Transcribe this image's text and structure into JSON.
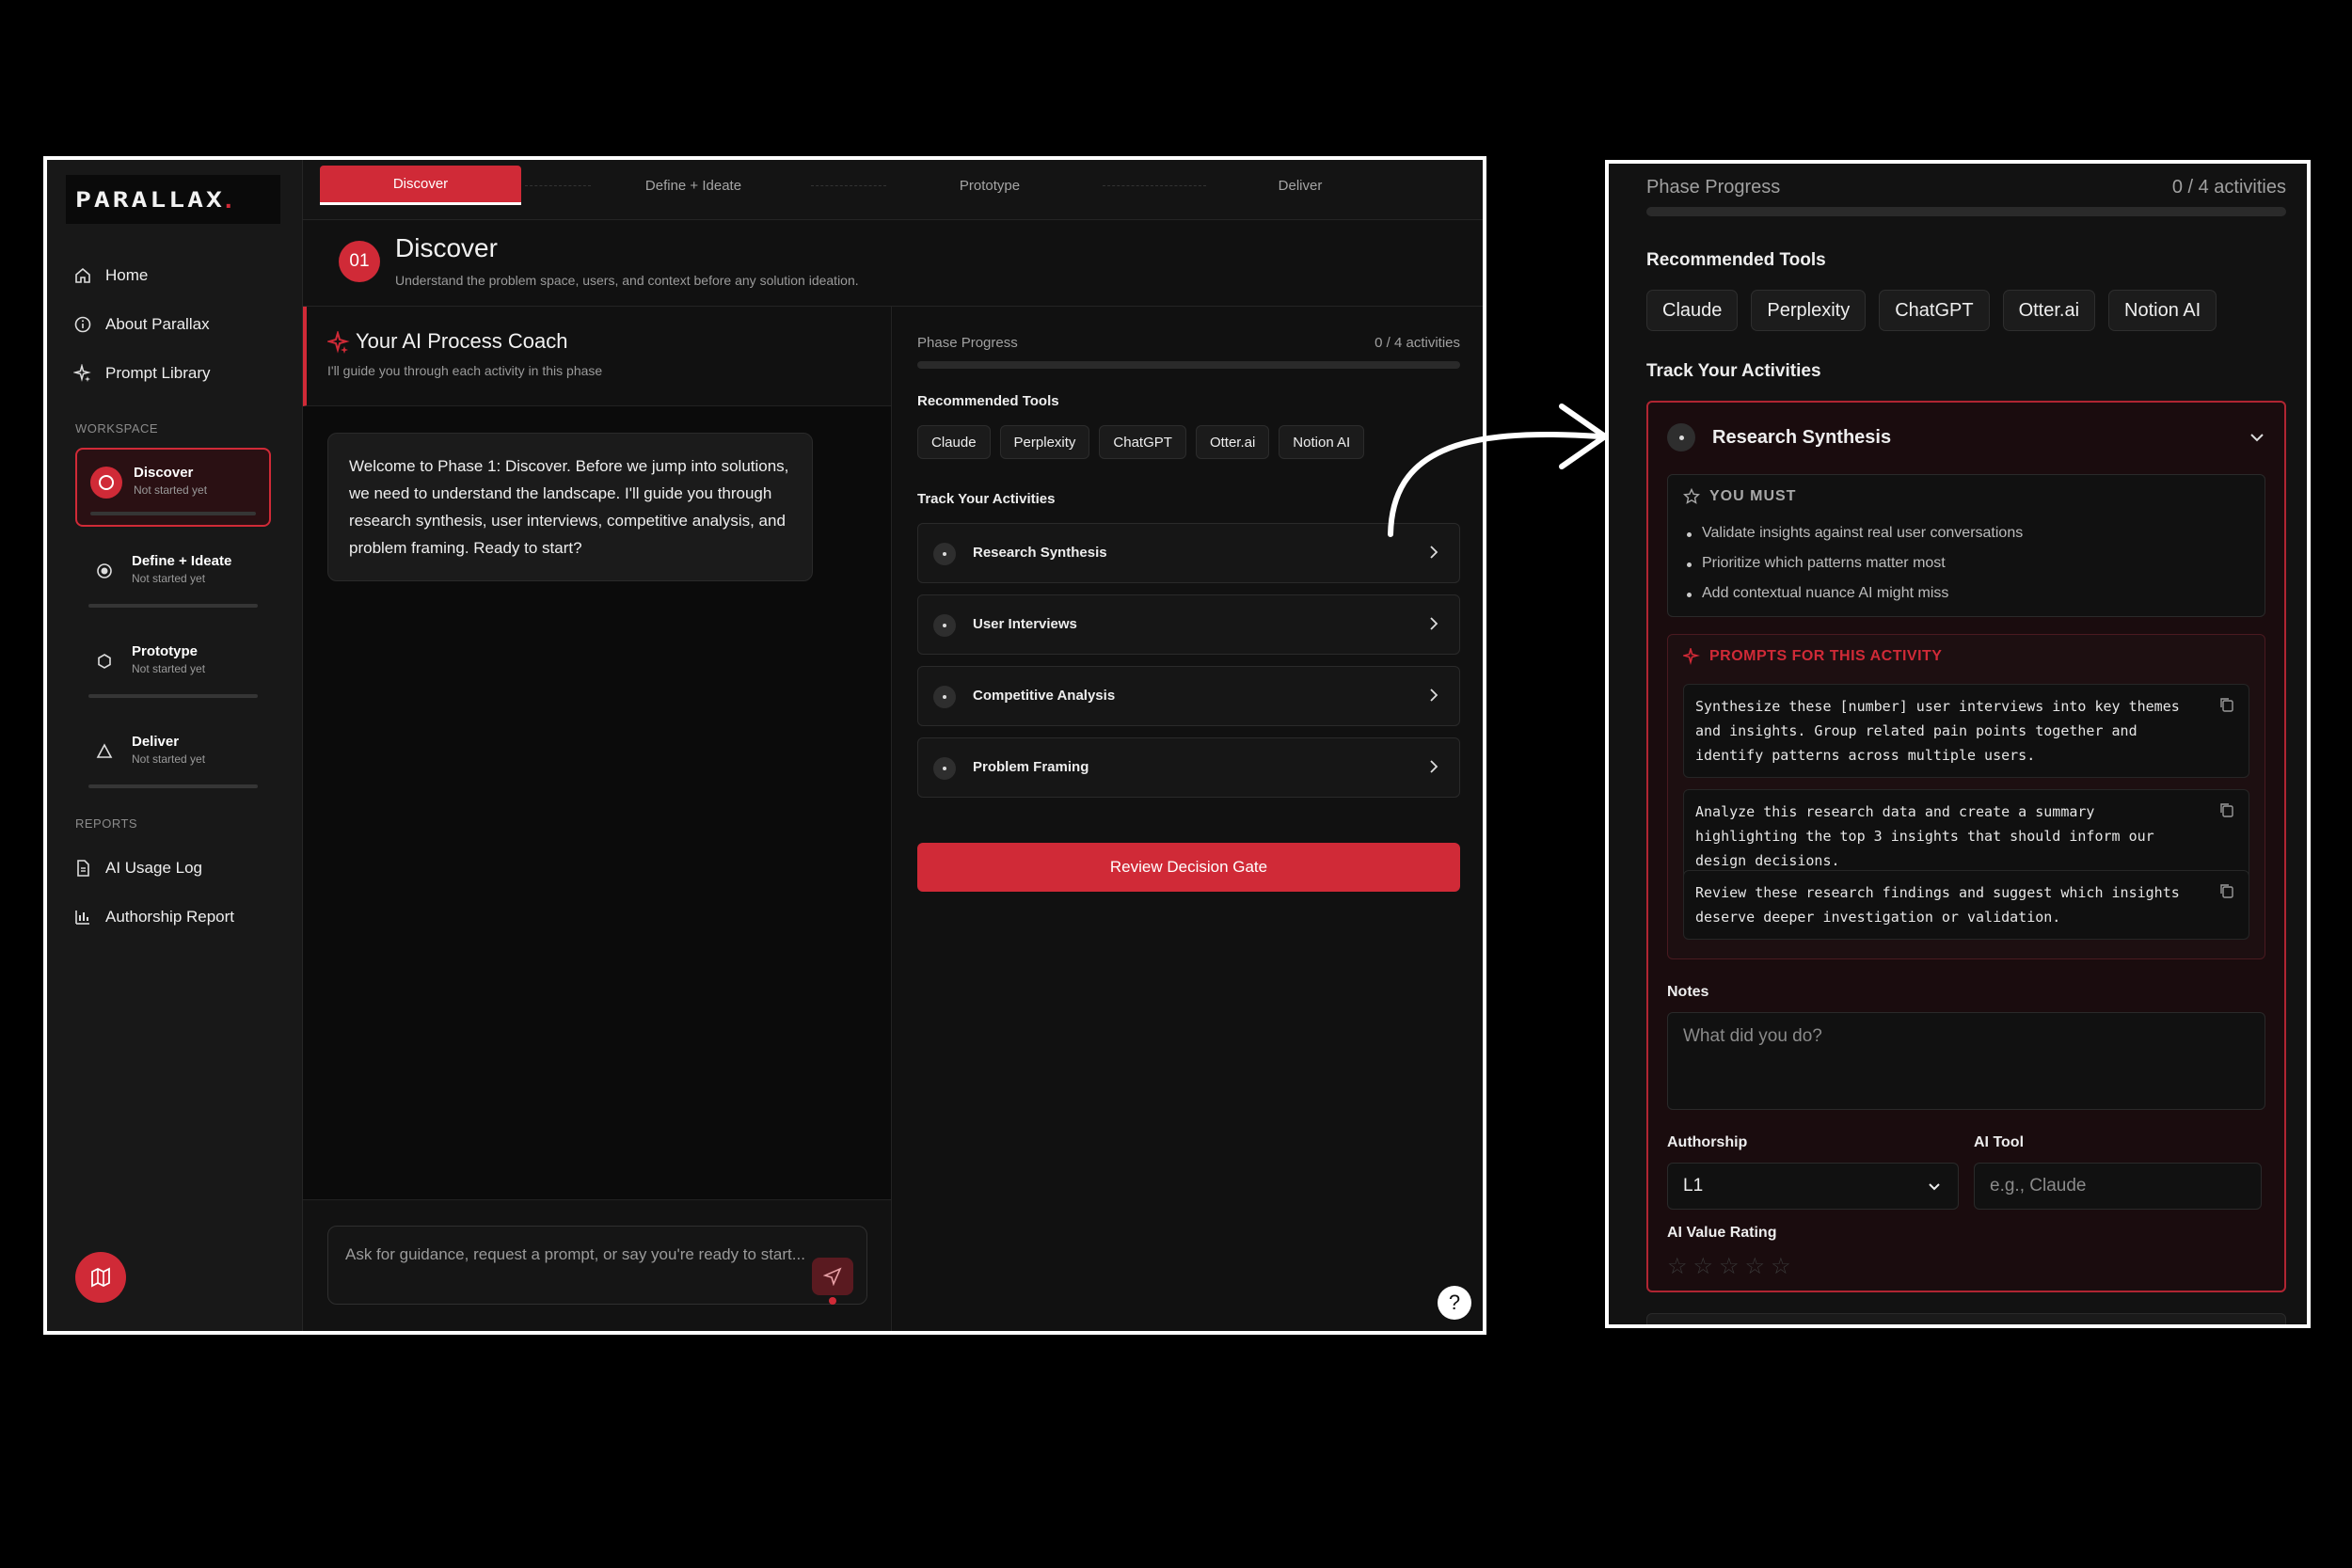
{
  "app": {
    "logo_text": "PARALLAX",
    "logo_dot": ".",
    "nav": [
      {
        "label": "Home",
        "icon": "home-icon"
      },
      {
        "label": "About Parallax",
        "icon": "info-icon"
      },
      {
        "label": "Prompt Library",
        "icon": "sparkle-icon"
      }
    ],
    "workspace_label": "WORKSPACE",
    "phases": [
      {
        "name": "Discover",
        "status": "Not started yet",
        "icon": "circle-icon",
        "active": true
      },
      {
        "name": "Define + Ideate",
        "status": "Not started yet",
        "icon": "target-icon",
        "active": false
      },
      {
        "name": "Prototype",
        "status": "Not started yet",
        "icon": "hexagon-icon",
        "active": false
      },
      {
        "name": "Deliver",
        "status": "Not started yet",
        "icon": "triangle-icon",
        "active": false
      }
    ],
    "reports_label": "REPORTS",
    "reports": [
      {
        "label": "AI Usage Log",
        "icon": "document-icon"
      },
      {
        "label": "Authorship Report",
        "icon": "bar-chart-icon"
      }
    ],
    "tabs": [
      "Discover",
      "Define + Ideate",
      "Prototype",
      "Deliver"
    ],
    "phase_header": {
      "number": "01",
      "title": "Discover",
      "subtitle": "Understand the problem space, users, and context before any solution ideation."
    },
    "coach": {
      "title": "Your AI Process Coach",
      "subtitle": "I'll guide you through each activity in this phase",
      "message": "Welcome to Phase 1: Discover. Before we jump into solutions, we need to understand the landscape. I'll guide you through research synthesis, user interviews, competitive analysis, and problem framing. Ready to start?",
      "input_placeholder": "Ask for guidance, request a prompt, or say you're ready to start..."
    },
    "panel": {
      "progress_label": "Phase Progress",
      "progress_count": "0 / 4 activities",
      "progress_value": 0,
      "tools_label": "Recommended Tools",
      "tools": [
        "Claude",
        "Perplexity",
        "ChatGPT",
        "Otter.ai",
        "Notion AI"
      ],
      "activities_label": "Track Your Activities",
      "activities": [
        "Research Synthesis",
        "User Interviews",
        "Competitive Analysis",
        "Problem Framing"
      ],
      "gate_button": "Review Decision Gate"
    },
    "help_label": "?"
  },
  "zoom": {
    "progress_label": "Phase Progress",
    "progress_count": "0 / 4 activities",
    "tools_label": "Recommended Tools",
    "tools": [
      "Claude",
      "Perplexity",
      "ChatGPT",
      "Otter.ai",
      "Notion AI"
    ],
    "activities_label": "Track Your Activities",
    "activity_title": "Research Synthesis",
    "must_title": "YOU MUST",
    "must_items": [
      "Validate insights against real user conversations",
      "Prioritize which patterns matter most",
      "Add contextual nuance AI might miss"
    ],
    "prompts_title": "PROMPTS FOR THIS ACTIVITY",
    "prompts": [
      "Synthesize these [number] user interviews into key themes and insights. Group related pain points together and identify patterns across multiple users.",
      "Analyze this research data and create a summary highlighting the top 3 insights that should inform our design decisions.",
      "Review these research findings and suggest which insights deserve deeper investigation or validation."
    ],
    "notes_label": "Notes",
    "notes_placeholder": "What did you do?",
    "authorship_label": "Authorship",
    "authorship_value": "L1",
    "ai_tool_label": "AI Tool",
    "ai_tool_placeholder": "e.g., Claude",
    "rating_label": "AI Value Rating",
    "rating_value": 0,
    "rating_max": 5
  },
  "colors": {
    "accent": "#d02a37",
    "background": "#0c0c0c"
  }
}
